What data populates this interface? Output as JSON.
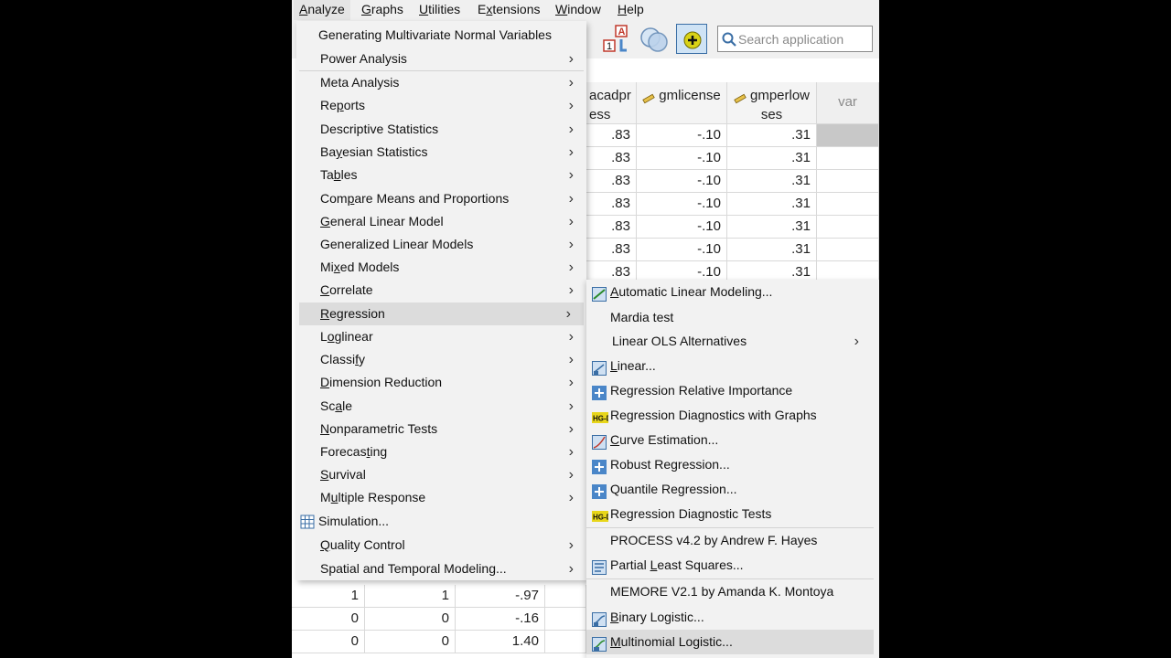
{
  "menubar": {
    "items": [
      {
        "label": "Analyze",
        "u": "A",
        "rest": "nalyze"
      },
      {
        "label": "Graphs",
        "u": "G",
        "rest": "raphs"
      },
      {
        "label": "Utilities",
        "u": "U",
        "rest": "tilities"
      },
      {
        "label": "Extensions",
        "u": "x",
        "pre": "E",
        "rest": "tensions"
      },
      {
        "label": "Window",
        "u": "W",
        "rest": "indow"
      },
      {
        "label": "Help",
        "u": "H",
        "rest": "elp"
      }
    ]
  },
  "search": {
    "placeholder": "Search application"
  },
  "grid": {
    "headers": [
      {
        "line1": "acadpr",
        "line2": "ess"
      },
      {
        "line1": "gmlicense",
        "line2": ""
      },
      {
        "line1": "gmperlow",
        "line2": "ses"
      },
      {
        "line1": "var",
        "line2": ""
      }
    ],
    "top_rows": [
      [
        ".83",
        "-.10",
        ".31"
      ],
      [
        ".83",
        "-.10",
        ".31"
      ],
      [
        ".83",
        "-.10",
        ".31"
      ],
      [
        ".83",
        "-.10",
        ".31"
      ],
      [
        ".83",
        "-.10",
        ".31"
      ],
      [
        ".83",
        "-.10",
        ".31"
      ],
      [
        ".83",
        "-.10",
        ".31"
      ]
    ],
    "bottom_rows": [
      [
        "1",
        "1",
        "-.97"
      ],
      [
        "0",
        "0",
        "-.16"
      ],
      [
        "0",
        "0",
        "1.40"
      ]
    ]
  },
  "analyze_menu": {
    "items": [
      {
        "label": "Generating Multivariate Normal Variables",
        "submenu": false
      },
      {
        "label": "Power Analysis",
        "submenu": true
      },
      {
        "label": "Meta Analysis",
        "submenu": true
      },
      {
        "label": "Reports",
        "submenu": true
      },
      {
        "label": "Descriptive Statistics",
        "submenu": true
      },
      {
        "label": "Bayesian Statistics",
        "submenu": true
      },
      {
        "label": "Tables",
        "submenu": true
      },
      {
        "label": "Compare Means and Proportions",
        "submenu": true
      },
      {
        "label": "General Linear Model",
        "submenu": true
      },
      {
        "label": "Generalized Linear Models",
        "submenu": true
      },
      {
        "label": "Mixed Models",
        "submenu": true
      },
      {
        "label": "Correlate",
        "submenu": true
      },
      {
        "label": "Regression",
        "submenu": true
      },
      {
        "label": "Loglinear",
        "submenu": true
      },
      {
        "label": "Classify",
        "submenu": true
      },
      {
        "label": "Dimension Reduction",
        "submenu": true
      },
      {
        "label": "Scale",
        "submenu": true
      },
      {
        "label": "Nonparametric Tests",
        "submenu": true
      },
      {
        "label": "Forecasting",
        "submenu": true
      },
      {
        "label": "Survival",
        "submenu": true
      },
      {
        "label": "Multiple Response",
        "submenu": true
      },
      {
        "label": "Simulation...",
        "submenu": false
      },
      {
        "label": "Quality Control",
        "submenu": true
      },
      {
        "label": "Spatial and Temporal Modeling...",
        "submenu": true
      }
    ]
  },
  "regression_menu": {
    "items": [
      {
        "label": "Automatic Linear Modeling...",
        "icon": "auto-linear-icon"
      },
      {
        "label": "Mardia test",
        "icon": ""
      },
      {
        "label": "Linear OLS Alternatives",
        "icon": "",
        "submenu": true
      },
      {
        "label": "Linear...",
        "icon": "linear-icon"
      },
      {
        "label": "Regression Relative Importance",
        "icon": "plus-icon"
      },
      {
        "label": "Regression Diagnostics with Graphs",
        "icon": "hg-icon"
      },
      {
        "label": "Curve Estimation...",
        "icon": "curve-icon"
      },
      {
        "label": "Robust Regression...",
        "icon": "plus-icon"
      },
      {
        "label": "Quantile Regression...",
        "icon": "plus-icon"
      },
      {
        "label": "Regression Diagnostic Tests",
        "icon": "hg-icon"
      },
      {
        "label": "PROCESS v4.2 by Andrew F. Hayes",
        "icon": ""
      },
      {
        "label": "Partial Least Squares...",
        "icon": "pls-icon"
      },
      {
        "label": "MEMORE V2.1 by Amanda K. Montoya",
        "icon": ""
      },
      {
        "label": "Binary Logistic...",
        "icon": "logistic-icon"
      },
      {
        "label": "Multinomial Logistic...",
        "icon": "multinomial-icon"
      }
    ]
  },
  "colors": {
    "accent": "#4a86c8",
    "highlight": "#dcdcdc",
    "menu_bg": "#f2f2f2"
  }
}
